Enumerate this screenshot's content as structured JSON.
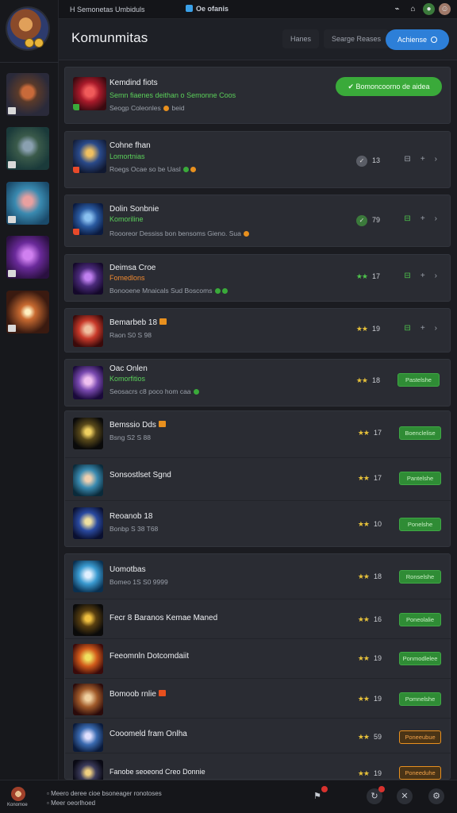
{
  "topbar": {
    "left_text": "H Semonetas Umbiduls",
    "center_text": "Oe ofanis",
    "icons": [
      "link-icon",
      "bell-icon",
      "status-icon",
      "user-avatar"
    ]
  },
  "header": {
    "title": "Komunmitas",
    "btn_a": "Hanes",
    "btn_b": "Searge Reases",
    "primary": "Achiense"
  },
  "featured": {
    "title": "Kemdind fiots",
    "sub": "Semn fiaenes deithan  o  Semonne  Coos",
    "meta": "Seogp Coleonles",
    "meta_end": "beid",
    "action": "Bomoncoorno de aidea"
  },
  "rows": [
    {
      "title": "Cohne fhan",
      "sub": "Lomortnias",
      "meta": "Roegs Ocae so be Uasl",
      "count": "13",
      "mode": "circle"
    },
    {
      "title": "Dolin Sonbnie",
      "sub": "Komoriline",
      "meta": "Roooreor Dessiss bon bensoms  Gieno. Sua",
      "count": "79",
      "mode": "circle-green"
    },
    {
      "title": "Deimsa Croe",
      "sub": "Fomedlons",
      "meta": "Bonooene Mnaicals Sud Boscoms",
      "count": "17",
      "mode": "stars-green"
    },
    {
      "title": "Bemarbeb 18",
      "sub": "",
      "meta": "Raon S0 S 98",
      "count": "19",
      "mode": "stars"
    },
    {
      "title": "Oac Onlen",
      "sub": "Komorfitios",
      "meta": "Seosacrs c8 poco hom caa",
      "count": "18",
      "mode": "install"
    }
  ],
  "group1": [
    {
      "title": "Bemssio Dds",
      "meta": "Bsng S2 S 88",
      "count": "17",
      "btn": "Boenclelise"
    },
    {
      "title": "Sonsostlset Sgnd",
      "meta": "",
      "count": "17",
      "btn": "Pantelshe"
    },
    {
      "title": "Reoanob 18",
      "meta": "Bonbp S 38 T68",
      "count": "10",
      "btn": "Ponelshe"
    }
  ],
  "group2": [
    {
      "title": "Uomotbas",
      "meta": "Bomeo 1S S0 9999",
      "count": "18",
      "btn": "Ronselshe",
      "orange": false
    },
    {
      "title": "Fecr 8 Baranos Kemae Maned",
      "meta": "",
      "count": "16",
      "btn": "Poneolalie",
      "orange": false
    },
    {
      "title": "Feeomnln Dotcomdaiit",
      "meta": "",
      "count": "19",
      "btn": "Ponmodlelee",
      "orange": false
    },
    {
      "title": "Bomoob rnlie",
      "meta": "",
      "count": "19",
      "btn": "Pomnelshe",
      "orange": false
    },
    {
      "title": "Cooomeld fram Onlha",
      "meta": "",
      "count": "59",
      "btn": "Poneeubue",
      "orange": true
    },
    {
      "title": "Fanobe seoeond Creo Donnie",
      "meta": "",
      "count": "19",
      "btn": "Poneeduhe",
      "orange": true
    }
  ],
  "footer": {
    "name": "Konomoe",
    "line1": "Meero deree cioe bsoneager ronotoses",
    "line2": "Meer oeorlhoed"
  },
  "colors": {
    "accent_blue": "#2d7fd8",
    "accent_green": "#3aaa3a",
    "accent_orange": "#e8901e",
    "background": "#1b1c21",
    "card": "#2a2c33"
  }
}
